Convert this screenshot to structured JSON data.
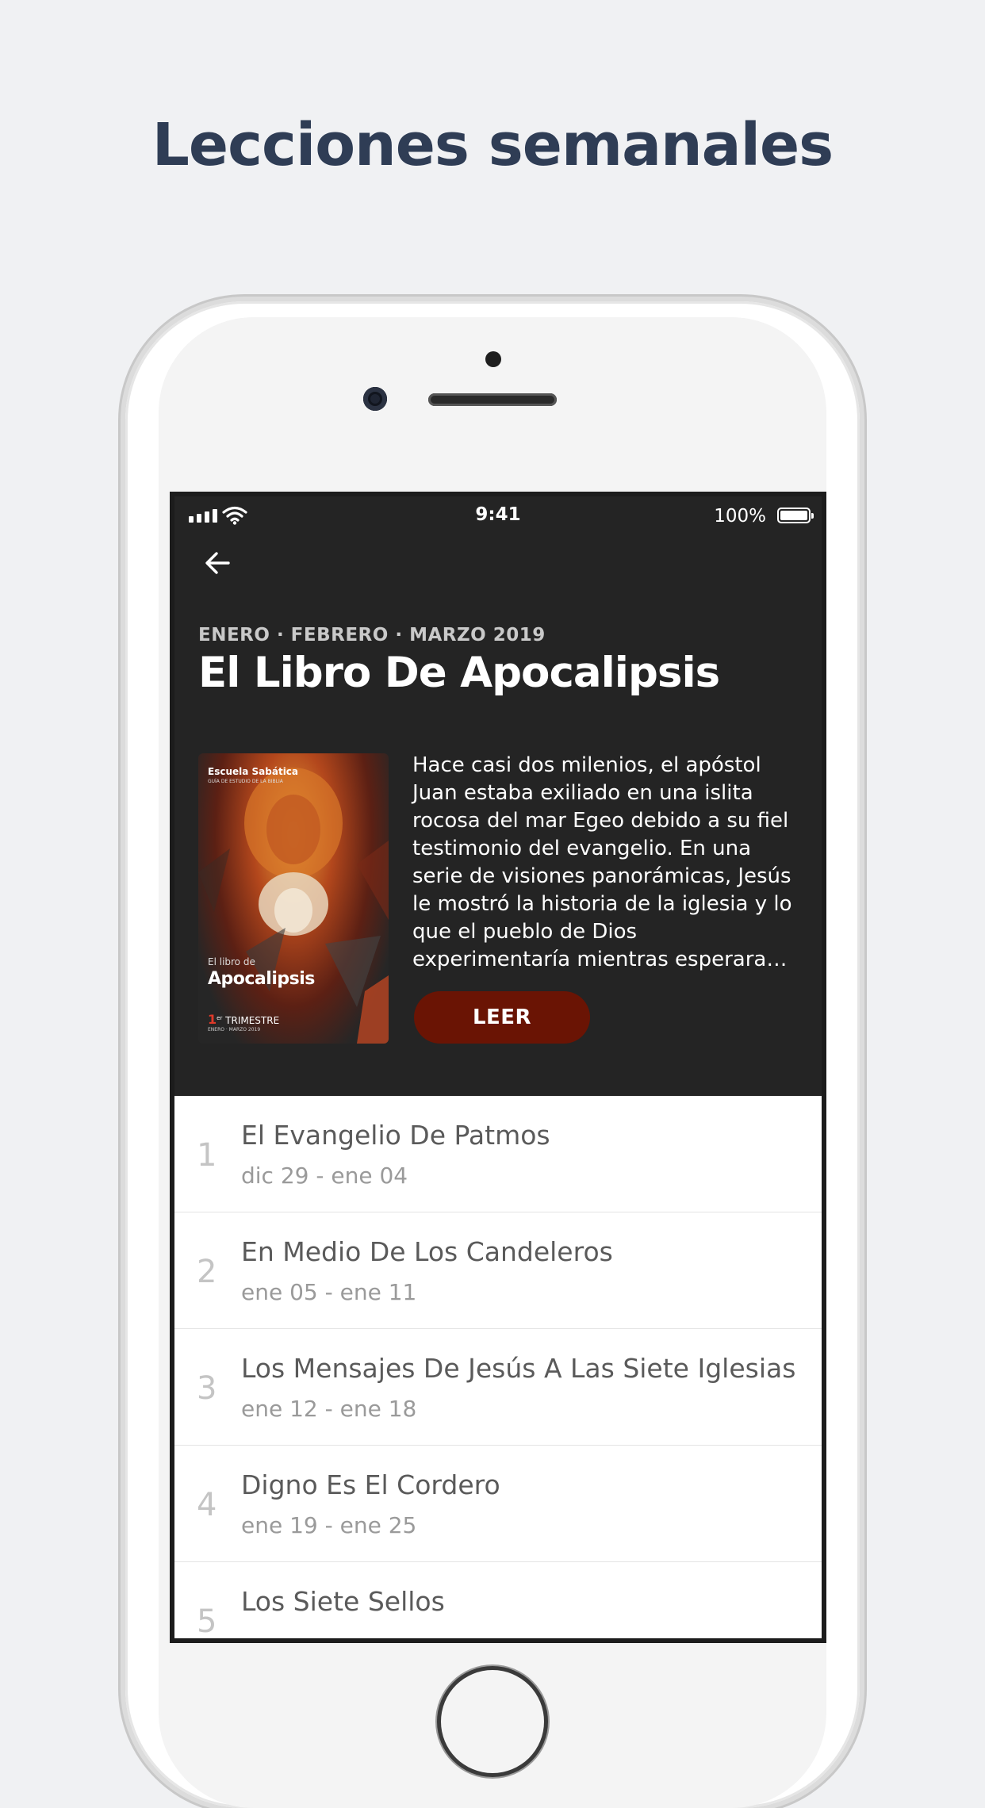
{
  "headline": "Lecciones semanales",
  "status_bar": {
    "time": "9:41",
    "battery": "100%"
  },
  "quarter": {
    "date_range": "ENERO · FEBRERO · MARZO 2019",
    "title": "El Libro De Apocalipsis",
    "description": "Hace casi dos milenios, el apóstol Juan estaba exiliado en una islita rocosa del mar Egeo debido a su fiel testimonio del evangelio. En una serie de visiones panorámicas, Jesús le mostró la historia de la iglesia y lo que el pueblo de Dios experimentaría mientras esperara…",
    "read_button": "LEER",
    "cover": {
      "series": "Escuela Sabática",
      "subtitle": "GUÍA DE ESTUDIO DE LA BIBLIA",
      "pre_title": "El libro de",
      "name": "Apocalipsis",
      "trimester_num": "1",
      "trimester_sup": "er",
      "trimester": "TRIMESTRE",
      "trimester_dates": "ENERO · MARZO 2019"
    }
  },
  "lessons": [
    {
      "number": "1",
      "title": "El Evangelio De Patmos",
      "date": "dic 29 - ene 04"
    },
    {
      "number": "2",
      "title": "En Medio De Los Candeleros",
      "date": "ene 05 - ene 11"
    },
    {
      "number": "3",
      "title": "Los Mensajes De Jesús A Las Siete Iglesias",
      "date": "ene 12 - ene 18"
    },
    {
      "number": "4",
      "title": "Digno Es El Cordero",
      "date": "ene 19 - ene 25"
    },
    {
      "number": "5",
      "title": "Los Siete Sellos",
      "date": ""
    }
  ],
  "colors": {
    "background": "#f0f1f3",
    "headline": "#2f3d55",
    "header_bg": "#242424",
    "read_button": "#6a1404"
  },
  "icons": [
    "cellular-signal-icon",
    "wifi-icon",
    "battery-icon",
    "back-arrow-icon"
  ]
}
